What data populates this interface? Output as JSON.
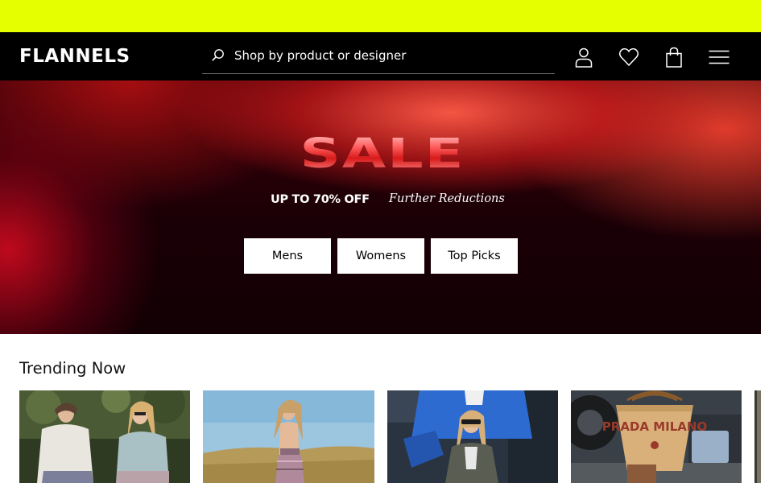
{
  "brand": {
    "logo_text": "FLANNELS"
  },
  "search": {
    "placeholder": "Shop by product or designer"
  },
  "header_icons": [
    "account-icon",
    "wishlist-icon",
    "bag-icon",
    "menu-icon"
  ],
  "colors": {
    "promo_bar": "#e6ff00",
    "header_bg": "#000000",
    "hero_accent": "#e8232b"
  },
  "hero": {
    "title": "SALE",
    "subtitle": "UP TO 70% OFF",
    "tagline": "Further Reductions",
    "buttons": [
      {
        "label": "Mens"
      },
      {
        "label": "Womens"
      },
      {
        "label": "Top Picks"
      }
    ]
  },
  "trending": {
    "title": "Trending Now",
    "tiles": [
      {
        "image": "two-models-outdoor-photo",
        "badge_text": ""
      },
      {
        "image": "model-desert-photo",
        "badge_text": ""
      },
      {
        "image": "model-blue-jacket-photo",
        "badge_text": ""
      },
      {
        "image": "prada-basket-bag-photo",
        "badge_text": "PRADA MILANO"
      }
    ]
  }
}
